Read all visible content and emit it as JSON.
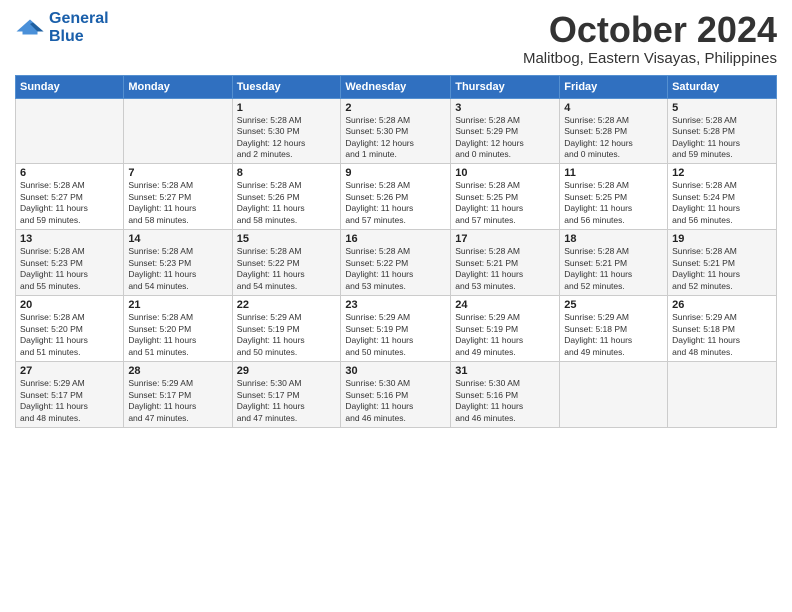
{
  "logo": {
    "line1": "General",
    "line2": "Blue",
    "tagline": ""
  },
  "title": "October 2024",
  "subtitle": "Malitbog, Eastern Visayas, Philippines",
  "weekdays": [
    "Sunday",
    "Monday",
    "Tuesday",
    "Wednesday",
    "Thursday",
    "Friday",
    "Saturday"
  ],
  "weeks": [
    [
      {
        "day": "",
        "info": ""
      },
      {
        "day": "",
        "info": ""
      },
      {
        "day": "1",
        "info": "Sunrise: 5:28 AM\nSunset: 5:30 PM\nDaylight: 12 hours\nand 2 minutes."
      },
      {
        "day": "2",
        "info": "Sunrise: 5:28 AM\nSunset: 5:30 PM\nDaylight: 12 hours\nand 1 minute."
      },
      {
        "day": "3",
        "info": "Sunrise: 5:28 AM\nSunset: 5:29 PM\nDaylight: 12 hours\nand 0 minutes."
      },
      {
        "day": "4",
        "info": "Sunrise: 5:28 AM\nSunset: 5:28 PM\nDaylight: 12 hours\nand 0 minutes."
      },
      {
        "day": "5",
        "info": "Sunrise: 5:28 AM\nSunset: 5:28 PM\nDaylight: 11 hours\nand 59 minutes."
      }
    ],
    [
      {
        "day": "6",
        "info": "Sunrise: 5:28 AM\nSunset: 5:27 PM\nDaylight: 11 hours\nand 59 minutes."
      },
      {
        "day": "7",
        "info": "Sunrise: 5:28 AM\nSunset: 5:27 PM\nDaylight: 11 hours\nand 58 minutes."
      },
      {
        "day": "8",
        "info": "Sunrise: 5:28 AM\nSunset: 5:26 PM\nDaylight: 11 hours\nand 58 minutes."
      },
      {
        "day": "9",
        "info": "Sunrise: 5:28 AM\nSunset: 5:26 PM\nDaylight: 11 hours\nand 57 minutes."
      },
      {
        "day": "10",
        "info": "Sunrise: 5:28 AM\nSunset: 5:25 PM\nDaylight: 11 hours\nand 57 minutes."
      },
      {
        "day": "11",
        "info": "Sunrise: 5:28 AM\nSunset: 5:25 PM\nDaylight: 11 hours\nand 56 minutes."
      },
      {
        "day": "12",
        "info": "Sunrise: 5:28 AM\nSunset: 5:24 PM\nDaylight: 11 hours\nand 56 minutes."
      }
    ],
    [
      {
        "day": "13",
        "info": "Sunrise: 5:28 AM\nSunset: 5:23 PM\nDaylight: 11 hours\nand 55 minutes."
      },
      {
        "day": "14",
        "info": "Sunrise: 5:28 AM\nSunset: 5:23 PM\nDaylight: 11 hours\nand 54 minutes."
      },
      {
        "day": "15",
        "info": "Sunrise: 5:28 AM\nSunset: 5:22 PM\nDaylight: 11 hours\nand 54 minutes."
      },
      {
        "day": "16",
        "info": "Sunrise: 5:28 AM\nSunset: 5:22 PM\nDaylight: 11 hours\nand 53 minutes."
      },
      {
        "day": "17",
        "info": "Sunrise: 5:28 AM\nSunset: 5:21 PM\nDaylight: 11 hours\nand 53 minutes."
      },
      {
        "day": "18",
        "info": "Sunrise: 5:28 AM\nSunset: 5:21 PM\nDaylight: 11 hours\nand 52 minutes."
      },
      {
        "day": "19",
        "info": "Sunrise: 5:28 AM\nSunset: 5:21 PM\nDaylight: 11 hours\nand 52 minutes."
      }
    ],
    [
      {
        "day": "20",
        "info": "Sunrise: 5:28 AM\nSunset: 5:20 PM\nDaylight: 11 hours\nand 51 minutes."
      },
      {
        "day": "21",
        "info": "Sunrise: 5:28 AM\nSunset: 5:20 PM\nDaylight: 11 hours\nand 51 minutes."
      },
      {
        "day": "22",
        "info": "Sunrise: 5:29 AM\nSunset: 5:19 PM\nDaylight: 11 hours\nand 50 minutes."
      },
      {
        "day": "23",
        "info": "Sunrise: 5:29 AM\nSunset: 5:19 PM\nDaylight: 11 hours\nand 50 minutes."
      },
      {
        "day": "24",
        "info": "Sunrise: 5:29 AM\nSunset: 5:19 PM\nDaylight: 11 hours\nand 49 minutes."
      },
      {
        "day": "25",
        "info": "Sunrise: 5:29 AM\nSunset: 5:18 PM\nDaylight: 11 hours\nand 49 minutes."
      },
      {
        "day": "26",
        "info": "Sunrise: 5:29 AM\nSunset: 5:18 PM\nDaylight: 11 hours\nand 48 minutes."
      }
    ],
    [
      {
        "day": "27",
        "info": "Sunrise: 5:29 AM\nSunset: 5:17 PM\nDaylight: 11 hours\nand 48 minutes."
      },
      {
        "day": "28",
        "info": "Sunrise: 5:29 AM\nSunset: 5:17 PM\nDaylight: 11 hours\nand 47 minutes."
      },
      {
        "day": "29",
        "info": "Sunrise: 5:30 AM\nSunset: 5:17 PM\nDaylight: 11 hours\nand 47 minutes."
      },
      {
        "day": "30",
        "info": "Sunrise: 5:30 AM\nSunset: 5:16 PM\nDaylight: 11 hours\nand 46 minutes."
      },
      {
        "day": "31",
        "info": "Sunrise: 5:30 AM\nSunset: 5:16 PM\nDaylight: 11 hours\nand 46 minutes."
      },
      {
        "day": "",
        "info": ""
      },
      {
        "day": "",
        "info": ""
      }
    ]
  ]
}
